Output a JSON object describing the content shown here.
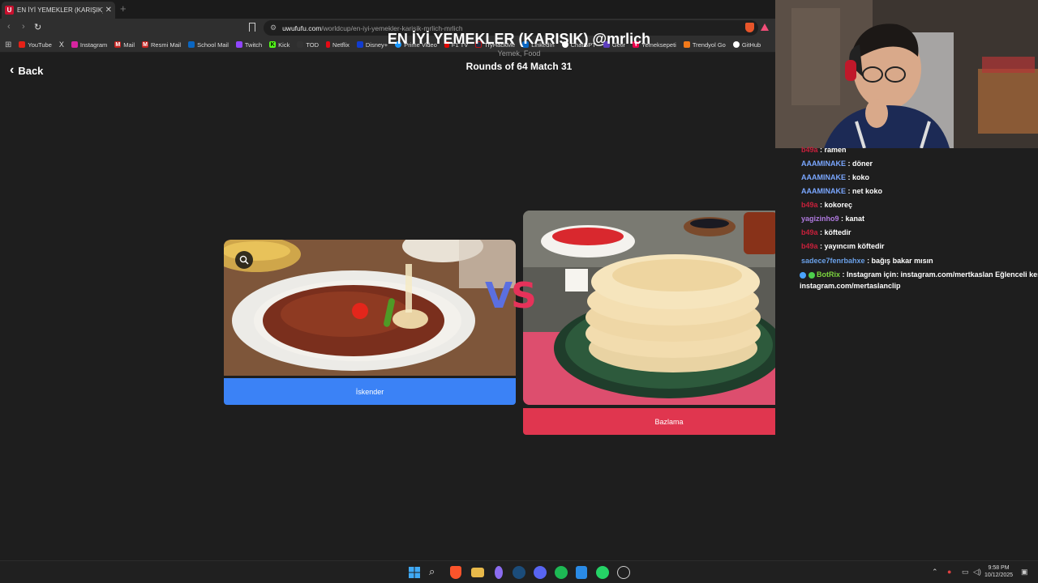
{
  "browser": {
    "tab_title": "EN İYİ YEMEKLER (KARIŞIK) @m",
    "tab_icon_letter": "U",
    "url_host": "uwufufu.com",
    "url_path": "/worldcup/en-iyi-yemekler-karisik-mrlich-mrlich",
    "bookmarks": [
      "YouTube",
      "X",
      "Instagram",
      "Mail",
      "Resmi Mail",
      "School Mail",
      "Twitch",
      "Kick",
      "TOD",
      "Netflix",
      "Disney+",
      "Prime Video",
      "F1 TV",
      "TryHackMe",
      "LinkedIn",
      "ChatGPT",
      "Getir",
      "Yemeksepeti",
      "Trendyol Go",
      "GitHub"
    ]
  },
  "page": {
    "back_label": "Back",
    "title": "EN İYİ YEMEKLER (KARIŞIK) @mrlich",
    "subtitle": "Yemek, Food",
    "round_label": "Rounds of 64 Match 31",
    "vs_v": "V",
    "vs_s": "S",
    "left_choice": {
      "label": "İskender",
      "button_color": "#3b82f6"
    },
    "right_choice": {
      "label": "Bazlama",
      "button_color": "#e0364f"
    }
  },
  "chat": {
    "messages": [
      {
        "user": "b49a",
        "text": ": ramen",
        "color": "#c8203b"
      },
      {
        "user": "AAAMINAKE",
        "text": ": döner",
        "color": "#7aa7ff"
      },
      {
        "user": "AAAMINAKE",
        "text": ": koko",
        "color": "#7aa7ff"
      },
      {
        "user": "AAAMINAKE",
        "text": ": net koko",
        "color": "#7aa7ff"
      },
      {
        "user": "b49a",
        "text": ": kokoreç",
        "color": "#c8203b"
      },
      {
        "user": "yagizinho9",
        "text": ": kanat",
        "color": "#b07ae0"
      },
      {
        "user": "b49a",
        "text": ": köftedir",
        "color": "#c8203b"
      },
      {
        "user": "b49a",
        "text": ": yayıncım köftedir",
        "color": "#c8203b"
      },
      {
        "user": "sadece7fenrbahxe",
        "text": ": bağış bakar mısın",
        "color": "#6aa0e8"
      },
      {
        "user": "BotRix",
        "text": ": Instagram için: instagram.com/mertkaslan Eğlenceli kesitler:",
        "color": "#7cd63e"
      },
      {
        "user": "",
        "text": "instagram.com/mertaslanclip",
        "color": "#ffffff"
      }
    ]
  },
  "taskbar": {
    "time": "9:58 PM",
    "date": "10/12/2025"
  }
}
